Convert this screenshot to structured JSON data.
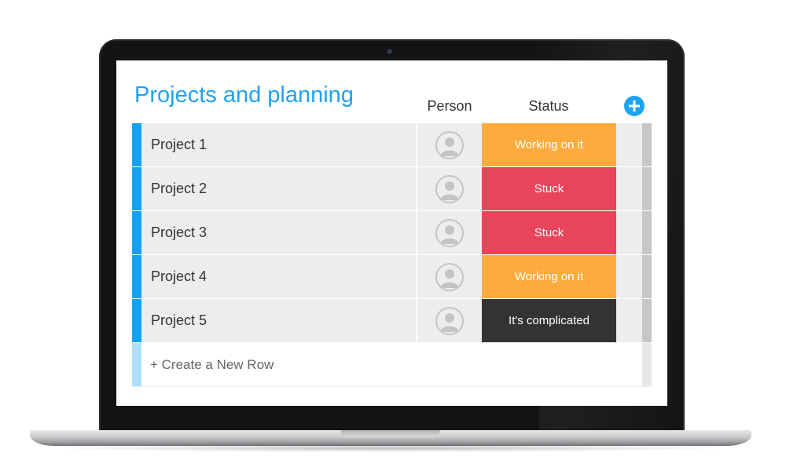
{
  "board": {
    "title": "Projects and planning",
    "columns": {
      "person": "Person",
      "status": "Status"
    },
    "rows": [
      {
        "name": "Project 1",
        "status": "Working on it",
        "status_color": "#fdab3d",
        "group_color": "#13a1f3"
      },
      {
        "name": "Project 2",
        "status": "Stuck",
        "status_color": "#e8455c",
        "group_color": "#13a1f3"
      },
      {
        "name": "Project 3",
        "status": "Stuck",
        "status_color": "#e8455c",
        "group_color": "#13a1f3"
      },
      {
        "name": "Project 4",
        "status": "Working on it",
        "status_color": "#fdab3d",
        "group_color": "#13a1f3"
      },
      {
        "name": "Project 5",
        "status": "It's complicated",
        "status_color": "#333333",
        "group_color": "#13a1f3"
      }
    ],
    "new_row_label": "+ Create a New Row",
    "icons": {
      "add_column": "plus-circle-icon",
      "person": "person-icon"
    },
    "accent_color": "#1ea3f0"
  }
}
